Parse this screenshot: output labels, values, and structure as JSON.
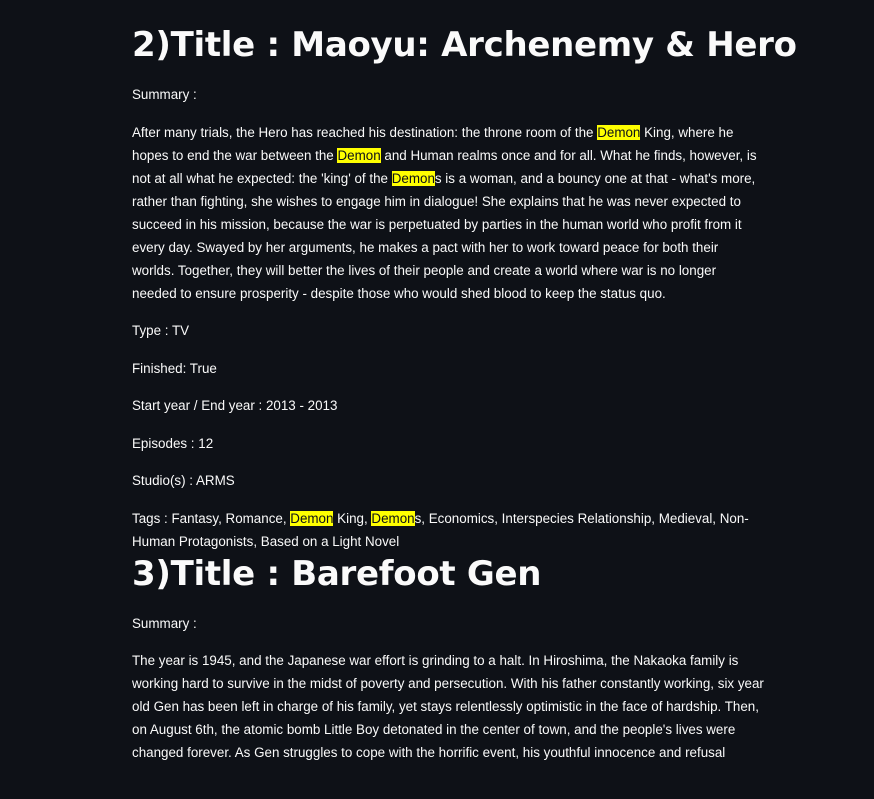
{
  "entries": [
    {
      "heading": "2)Title : Maoyu: Archenemy & Hero",
      "summary_label": "Summary :",
      "summary": [
        {
          "t": "After many trials, the Hero has reached his destination: the throne room of the "
        },
        {
          "h": "Demon"
        },
        {
          "t": " King, where he hopes to end the war between the "
        },
        {
          "h": "Demon"
        },
        {
          "t": " and Human realms once and for all. What he finds, however, is not at all what he expected: the 'king' of the "
        },
        {
          "h": "Demon"
        },
        {
          "t": "s is a woman, and a bouncy one at that - what's more, rather than fighting, she wishes to engage him in dialogue! She explains that he was never expected to succeed in his mission, because the war is perpetuated by parties in the human world who profit from it every day. Swayed by her arguments, he makes a pact with her to work toward peace for both their worlds. Together, they will better the lives of their people and create a world where war is no longer needed to ensure prosperity - despite those who would shed blood to keep the status quo."
        }
      ],
      "type_line": "Type : TV",
      "finished_line": "Finished: True",
      "years_line": "Start year / End year : 2013 - 2013",
      "episodes_line": "Episodes : 12",
      "studio_line": "Studio(s) : ARMS",
      "tags": [
        {
          "t": "Tags : Fantasy, Romance, "
        },
        {
          "h": "Demon"
        },
        {
          "t": " King, "
        },
        {
          "h": "Demon"
        },
        {
          "t": "s, Economics, Interspecies Relationship, Medieval, Non-Human Protagonists, Based on a Light Novel"
        }
      ]
    },
    {
      "heading": "3)Title : Barefoot Gen",
      "summary_label": "Summary :",
      "summary_text": "The year is 1945, and the Japanese war effort is grinding to a halt. In Hiroshima, the Nakaoka family is working hard to survive in the midst of poverty and persecution. With his father constantly working, six year old Gen has been left in charge of his family, yet stays relentlessly optimistic in the face of hardship. Then, on August 6th, the atomic bomb Little Boy detonated in the center of town, and the people's lives were changed forever. As Gen struggles to cope with the horrific event, his youthful innocence and refusal"
    }
  ],
  "colors": {
    "background": "#0e1117",
    "text": "#fafafa",
    "highlight": "#ffff00"
  }
}
